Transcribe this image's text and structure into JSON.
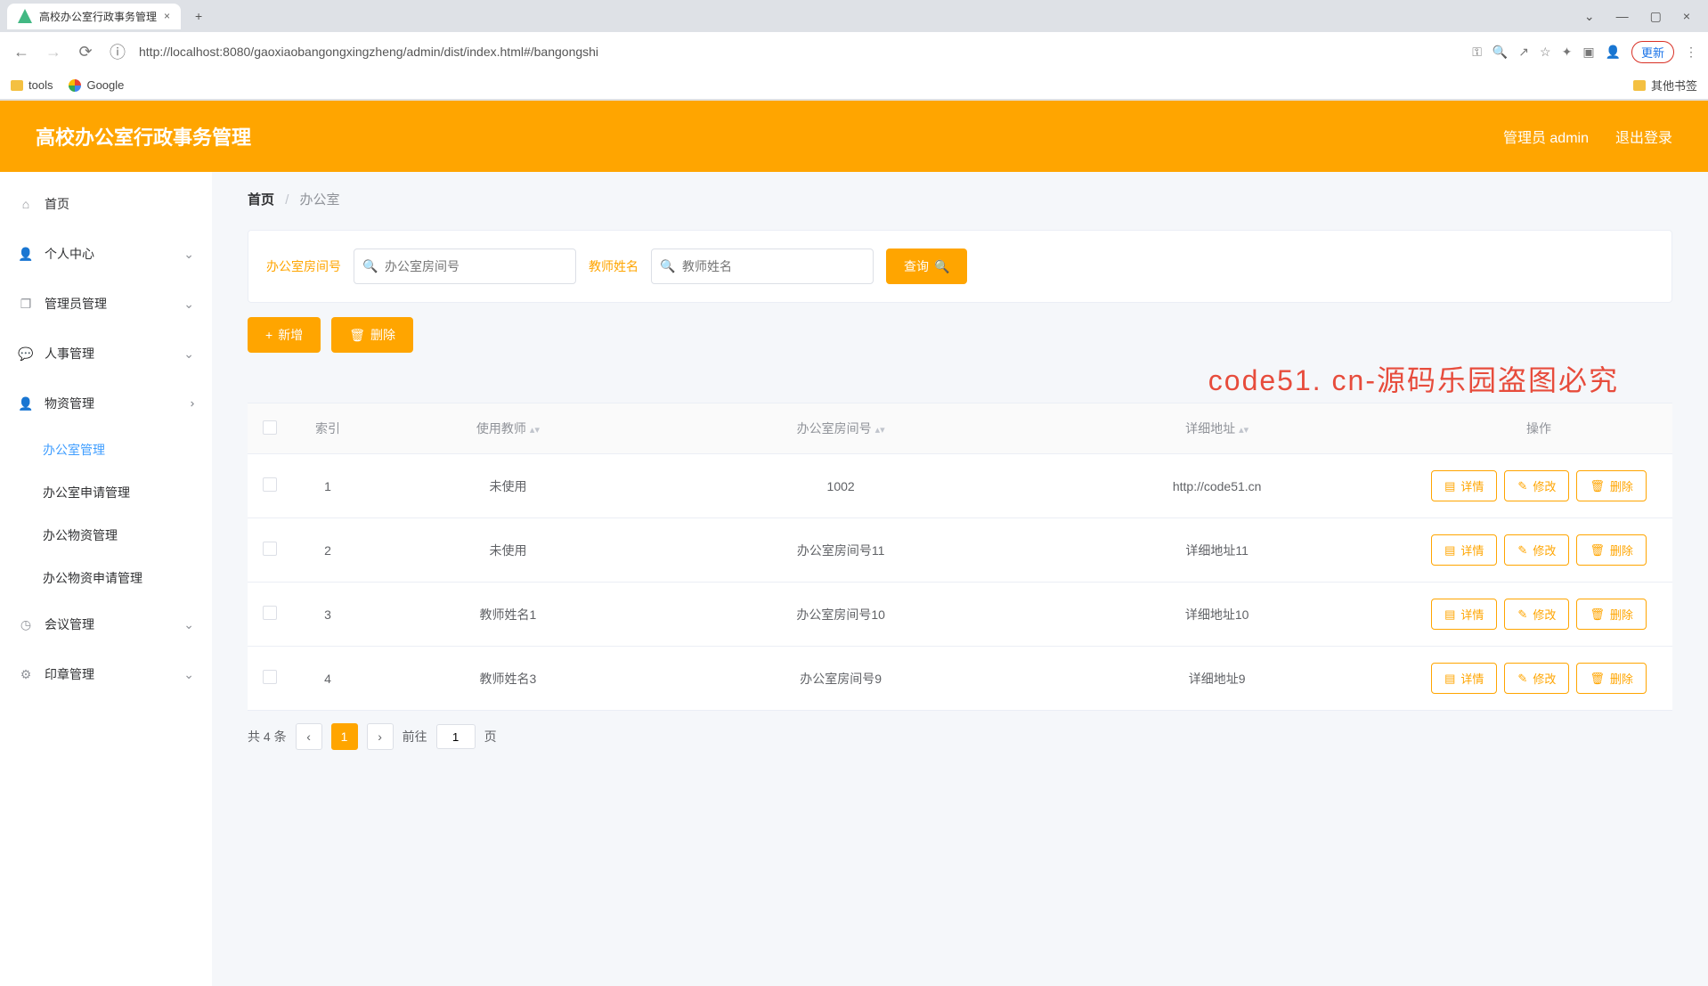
{
  "browser": {
    "tab_title": "高校办公室行政事务管理",
    "url": "http://localhost:8080/gaoxiaobangongxingzheng/admin/dist/index.html#/bangongshi",
    "update_btn": "更新",
    "bookmarks": {
      "tools": "tools",
      "google": "Google",
      "other": "其他书签"
    }
  },
  "header": {
    "title": "高校办公室行政事务管理",
    "user": "管理员 admin",
    "logout": "退出登录"
  },
  "sidebar": {
    "items": [
      {
        "label": "首页",
        "icon": "home"
      },
      {
        "label": "个人中心",
        "icon": "user"
      },
      {
        "label": "管理员管理",
        "icon": "copy"
      },
      {
        "label": "人事管理",
        "icon": "chat"
      },
      {
        "label": "物资管理",
        "icon": "user",
        "open": true,
        "children": [
          {
            "label": "办公室管理",
            "active": true
          },
          {
            "label": "办公室申请管理"
          },
          {
            "label": "办公物资管理"
          },
          {
            "label": "办公物资申请管理"
          }
        ]
      },
      {
        "label": "会议管理",
        "icon": "clock"
      },
      {
        "label": "印章管理",
        "icon": "gear"
      }
    ]
  },
  "breadcrumb": {
    "home": "首页",
    "current": "办公室"
  },
  "filters": {
    "room_label": "办公室房间号",
    "room_placeholder": "办公室房间号",
    "teacher_label": "教师姓名",
    "teacher_placeholder": "教师姓名",
    "search_btn": "查询"
  },
  "actions": {
    "add": "新增",
    "delete": "删除"
  },
  "watermark": "code51. cn-源码乐园盗图必究",
  "table": {
    "headers": {
      "index": "索引",
      "teacher": "使用教师",
      "room": "办公室房间号",
      "address": "详细地址",
      "ops": "操作"
    },
    "op_labels": {
      "detail": "详情",
      "edit": "修改",
      "delete": "删除"
    },
    "rows": [
      {
        "index": "1",
        "teacher": "未使用",
        "room": "1002",
        "address": "http://code51.cn"
      },
      {
        "index": "2",
        "teacher": "未使用",
        "room": "办公室房间号11",
        "address": "详细地址11"
      },
      {
        "index": "3",
        "teacher": "教师姓名1",
        "room": "办公室房间号10",
        "address": "详细地址10"
      },
      {
        "index": "4",
        "teacher": "教师姓名3",
        "room": "办公室房间号9",
        "address": "详细地址9"
      }
    ]
  },
  "pagination": {
    "total_text": "共 4 条",
    "current": "1",
    "goto": "前往",
    "page_suffix": "页",
    "goto_value": "1"
  }
}
